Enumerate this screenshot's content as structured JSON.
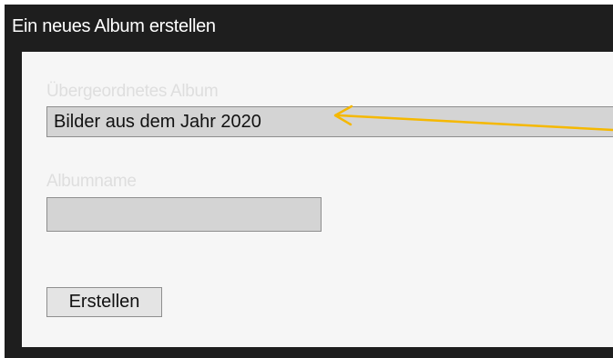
{
  "dialog": {
    "title": "Ein neues Album erstellen"
  },
  "form": {
    "parent_album_label": "Übergeordnetes Album",
    "parent_album_value": "Bilder aus dem Jahr 2020",
    "album_name_label": "Albumname",
    "album_name_value": "",
    "create_button_label": "Erstellen"
  },
  "colors": {
    "title_bar": "#1e1e1e",
    "body_background": "#f6f6f6",
    "field_background": "#d4d4d4",
    "annotation_arrow": "#f5b800"
  }
}
